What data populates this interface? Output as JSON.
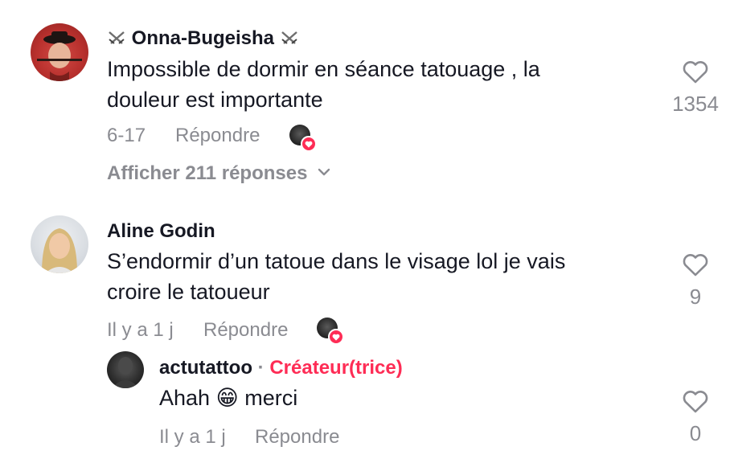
{
  "comments": [
    {
      "username": "Onna-Bugeisha",
      "text_line1": "Impossible de dormir en séance tatouage , la",
      "text_line2": "douleur est importante",
      "date": "6-17",
      "reply_label": "Répondre",
      "likes": "1354",
      "view_replies": "Afficher 211 réponses"
    },
    {
      "username": "Aline Godin",
      "text_line1": "S’endormir d’un tatoue dans le visage lol je vais",
      "text_line2": "croire le tatoueur",
      "date": "Il y a 1 j",
      "reply_label": "Répondre",
      "likes": "9"
    }
  ],
  "reply": {
    "username": "actutattoo",
    "separator": "·",
    "badge": "Créateur(trice)",
    "text_before": "Ahah",
    "emoji": "😁",
    "text_after": "merci",
    "date": "Il y a 1 j",
    "reply_label": "Répondre",
    "likes": "0"
  },
  "icons": {
    "heart": "heart-outline-icon",
    "chevron": "chevron-down-icon",
    "swords": "crossed-swords-icon"
  },
  "colors": {
    "text": "#161823",
    "muted": "#8a8b91",
    "accent": "#fe2c55"
  }
}
